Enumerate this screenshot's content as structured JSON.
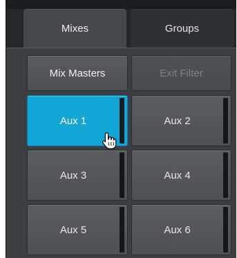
{
  "tabs": [
    {
      "label": "Mixes",
      "active": true
    },
    {
      "label": "Groups",
      "active": false
    }
  ],
  "filter_buttons": {
    "mix_masters": {
      "label": "Mix Masters",
      "enabled": true
    },
    "exit_filter": {
      "label": "Exit Filter",
      "enabled": false
    }
  },
  "aux_buttons": [
    {
      "label": "Aux 1",
      "selected": true
    },
    {
      "label": "Aux 2",
      "selected": false
    },
    {
      "label": "Aux 3",
      "selected": false
    },
    {
      "label": "Aux 4",
      "selected": false
    },
    {
      "label": "Aux 5",
      "selected": false
    },
    {
      "label": "Aux 6",
      "selected": false
    }
  ],
  "colors": {
    "selected_accent": "#12a6d6",
    "panel_background": "#3c3e42",
    "button_face": "#55575b"
  },
  "cursor": {
    "icon": "hand-pointer-icon"
  }
}
